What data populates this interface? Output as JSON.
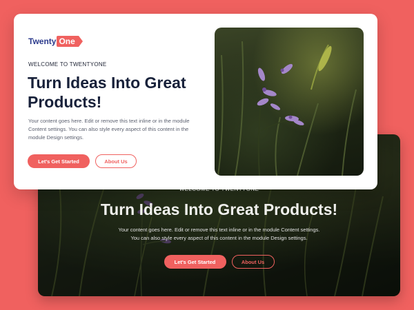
{
  "brand": {
    "logo_word": "Twenty",
    "logo_badge": "One"
  },
  "hero_card": {
    "eyebrow": "WELCOME TO TWENTYONE",
    "title": "Turn Ideas Into Great Products!",
    "description": "Your content goes here. Edit or remove this text inline or in the module Content settings. You can also style every aspect of this content in the module Design settings.",
    "primary_button": "Let's Get Started",
    "secondary_button": "About Us",
    "image_alt": "purple-wildflower-photo"
  },
  "hero_dark": {
    "eyebrow": "WELCOME TO TWENTYONE",
    "title": "Turn Ideas Into Great Products!",
    "description_line1": "Your content goes here. Edit or remove this text inline or in the module Content settings.",
    "description_line2": "You can also style every aspect of this content in the module Design settings.",
    "primary_button": "Let's Get Started",
    "secondary_button": "About Us"
  },
  "colors": {
    "background": "#f0615f",
    "accent": "#f0615f",
    "brand_navy": "#2b3a8c",
    "heading": "#18213a"
  }
}
